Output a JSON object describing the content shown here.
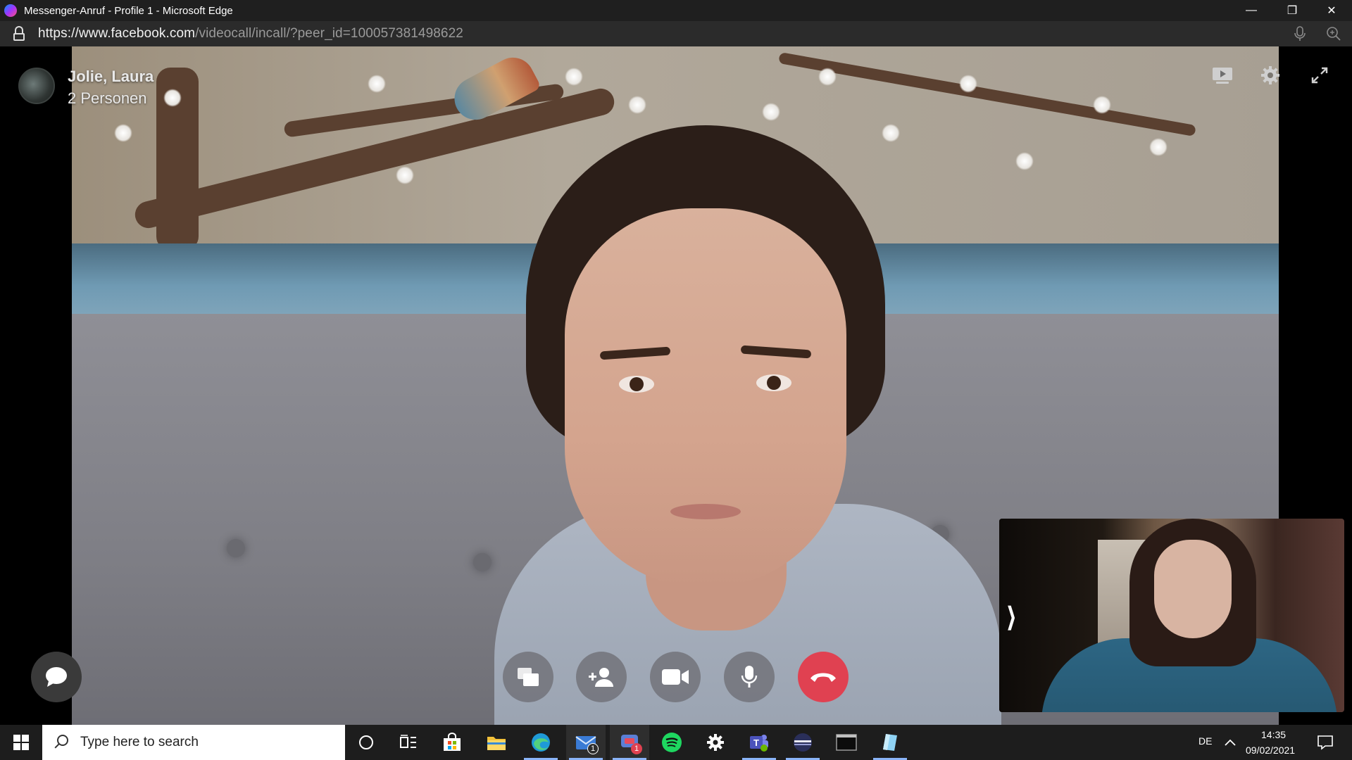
{
  "window": {
    "title": "Messenger-Anruf - Profile 1 - Microsoft Edge",
    "minimize_glyph": "—",
    "restore_glyph": "❐",
    "close_glyph": "✕"
  },
  "address_bar": {
    "scheme": "https://",
    "host": "www.facebook.com",
    "path": "/videocall/incall/?peer_id=100057381498622"
  },
  "call": {
    "caller_name": "Jolie, Laura",
    "participants": "2 Personen",
    "controls": [
      {
        "name": "share-screen",
        "icon": "screen-share-icon"
      },
      {
        "name": "add-person",
        "icon": "add-person-icon"
      },
      {
        "name": "video",
        "icon": "video-camera-icon"
      },
      {
        "name": "microphone",
        "icon": "microphone-icon"
      },
      {
        "name": "end-call",
        "icon": "end-call-icon",
        "color": "#e04151"
      }
    ],
    "top_icons": [
      "picture-in-picture-icon",
      "settings-icon",
      "fullscreen-icon"
    ],
    "self_view_toggle": "⟩"
  },
  "taskbar": {
    "search_placeholder": "Type here to search",
    "mail_badge": "1",
    "chat_badge": "1",
    "language": "DE",
    "time": "14:35",
    "date": "09/02/2021"
  },
  "colors": {
    "end_call": "#e04151",
    "taskbar": "#1d1d1d",
    "titlebar": "#1f1f1f"
  }
}
